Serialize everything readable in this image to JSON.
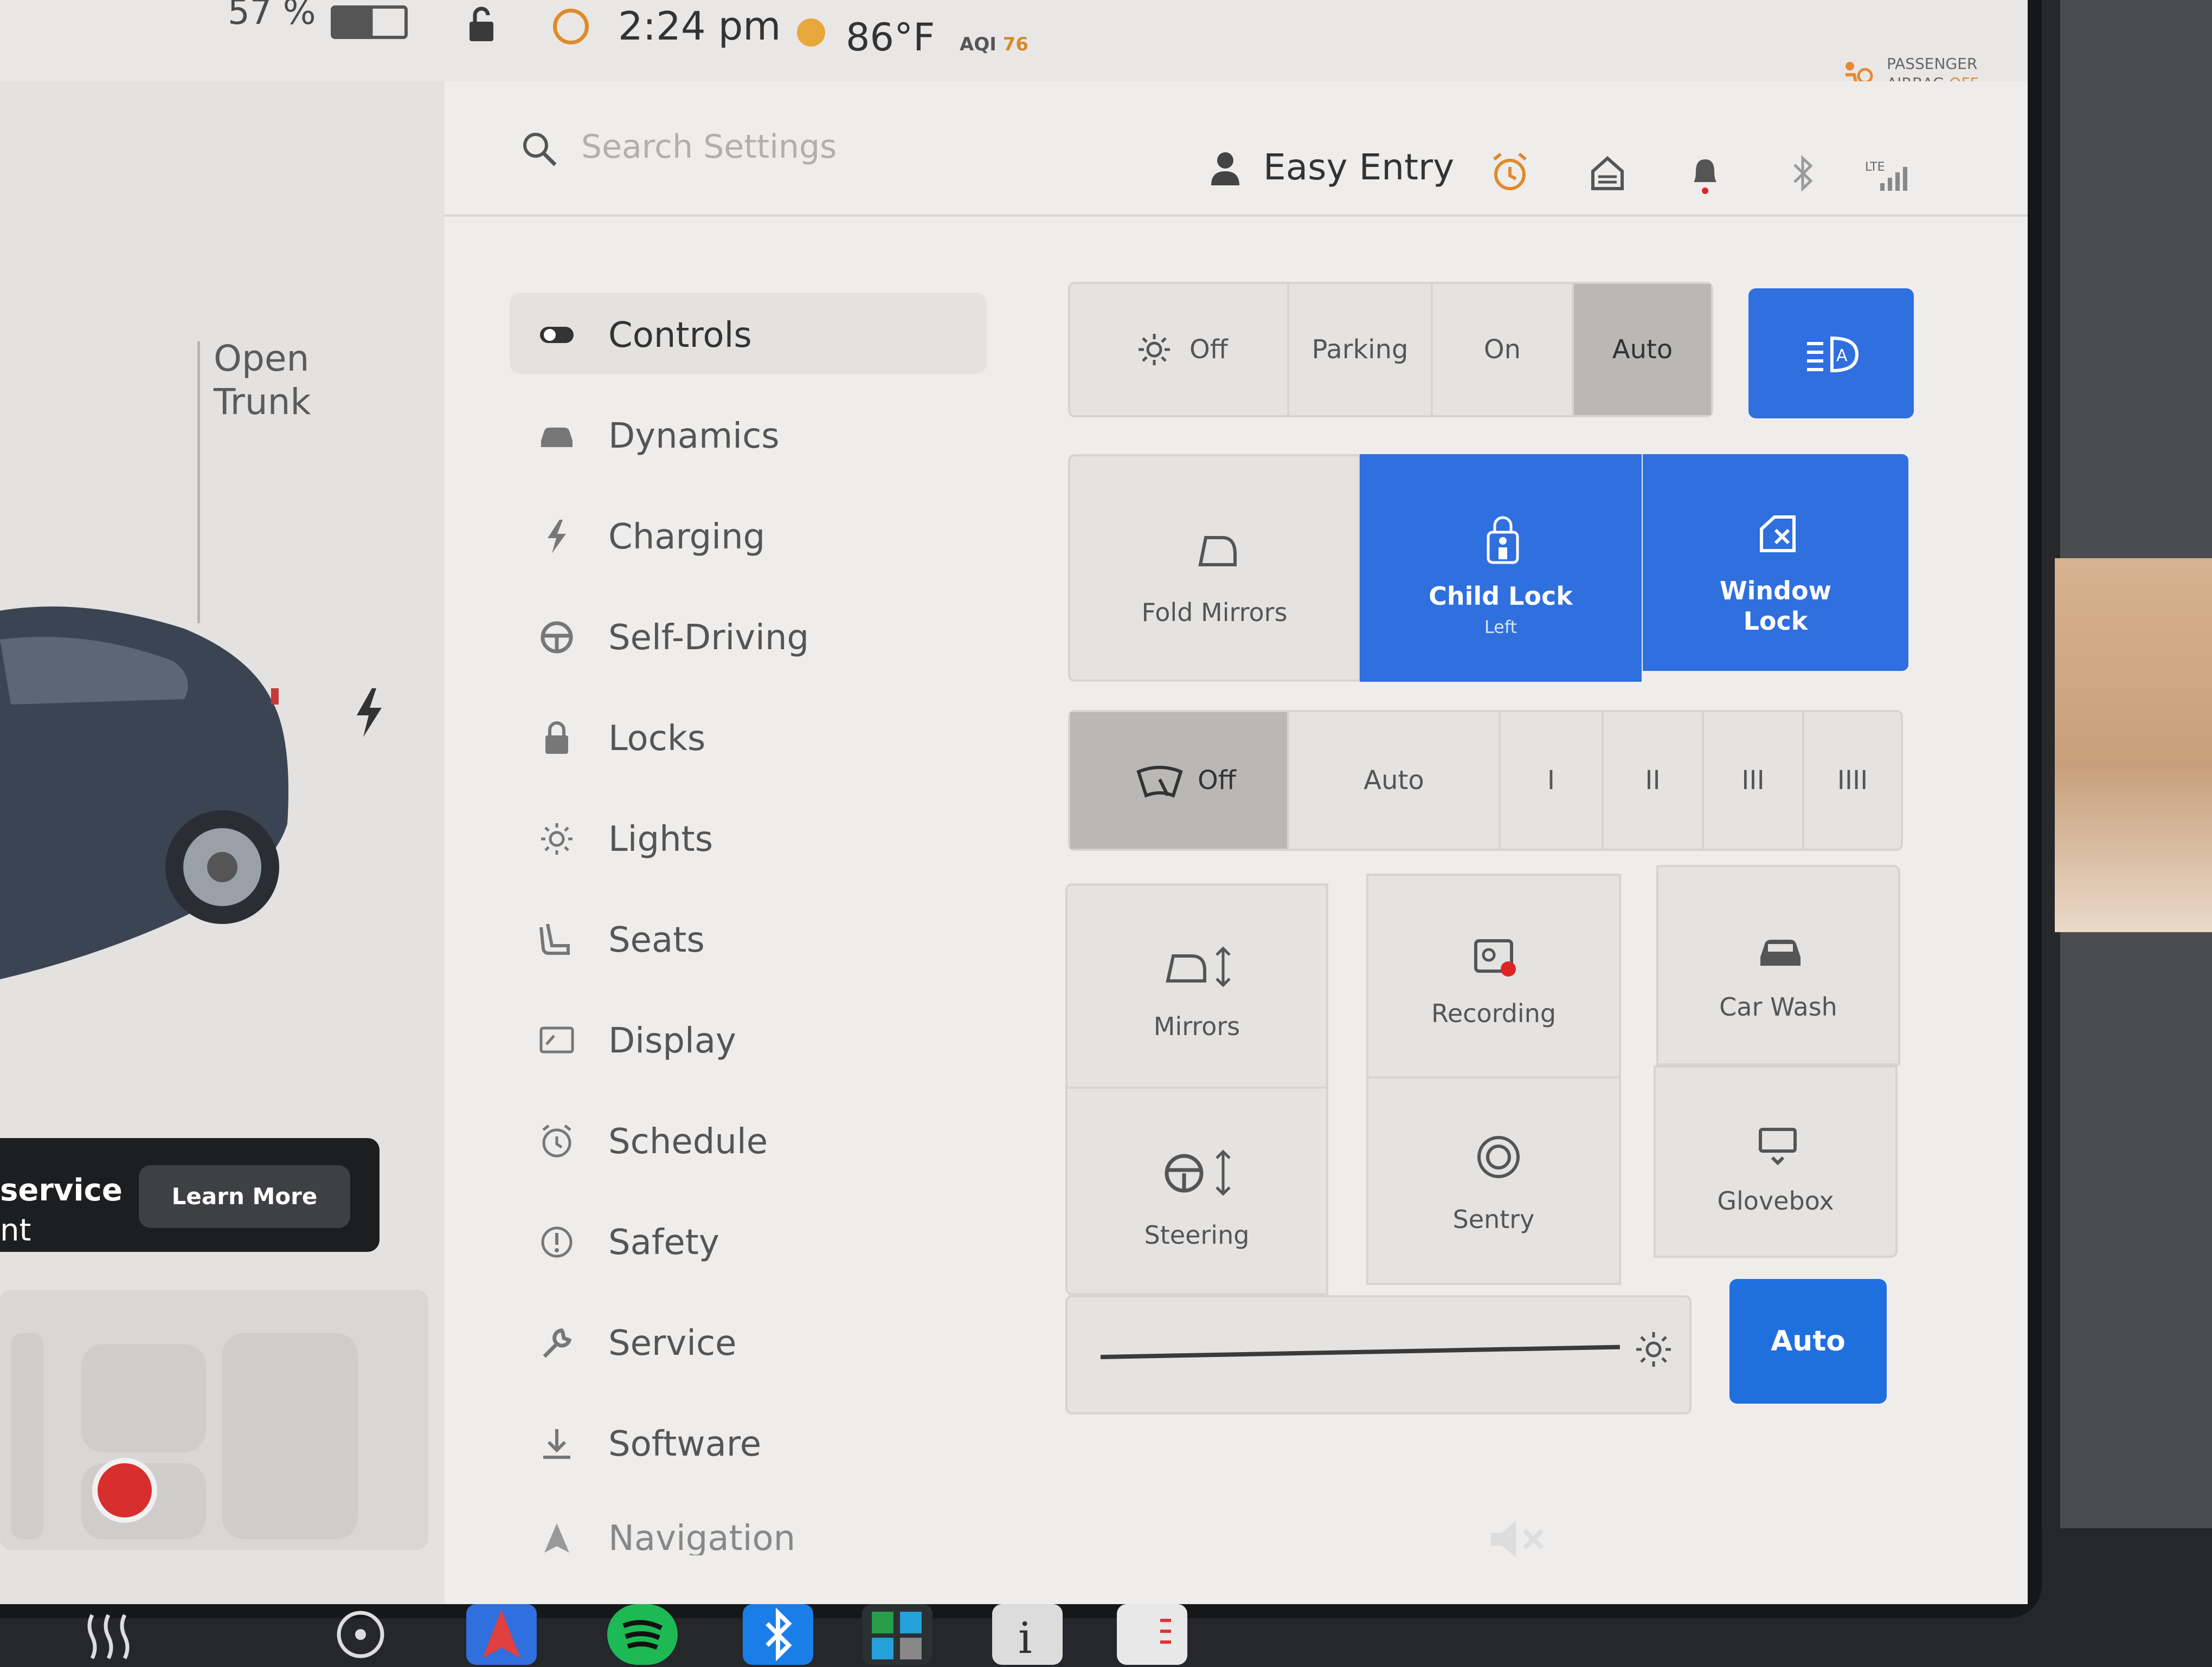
{
  "status": {
    "battery_percent": "57 %",
    "time": "2:24 pm",
    "temperature": "86°F",
    "aqi_label": "AQI",
    "aqi_value": "76",
    "airbag_line1": "PASSENGER",
    "airbag_line2": "AIRBAG",
    "airbag_state": "OFF",
    "lte": "LTE"
  },
  "car_panel": {
    "open_trunk_line1": "Open",
    "open_trunk_line2": "Trunk",
    "service_line1": "service",
    "service_line2": "nt",
    "learn_more": "Learn More"
  },
  "header": {
    "search_placeholder": "Search Settings",
    "profile_name": "Easy Entry"
  },
  "nav": {
    "items": [
      {
        "label": "Controls",
        "icon": "toggle-icon"
      },
      {
        "label": "Dynamics",
        "icon": "car-icon"
      },
      {
        "label": "Charging",
        "icon": "bolt-icon"
      },
      {
        "label": "Self-Driving",
        "icon": "steering-wheel-icon"
      },
      {
        "label": "Locks",
        "icon": "lock-icon"
      },
      {
        "label": "Lights",
        "icon": "light-icon"
      },
      {
        "label": "Seats",
        "icon": "seat-icon"
      },
      {
        "label": "Display",
        "icon": "display-icon"
      },
      {
        "label": "Schedule",
        "icon": "alarm-icon"
      },
      {
        "label": "Safety",
        "icon": "alert-icon"
      },
      {
        "label": "Service",
        "icon": "wrench-icon"
      },
      {
        "label": "Software",
        "icon": "download-icon"
      },
      {
        "label": "Navigation",
        "icon": "navigation-icon"
      }
    ]
  },
  "controls": {
    "headlights": {
      "off": "Off",
      "parking": "Parking",
      "on": "On",
      "auto": "Auto",
      "selected": "Auto"
    },
    "fold_mirrors": "Fold Mirrors",
    "child_lock": {
      "label": "Child Lock",
      "sub": "Left"
    },
    "window_lock": {
      "line1": "Window",
      "line2": "Lock"
    },
    "wipers": {
      "off": "Off",
      "auto": "Auto",
      "s1": "I",
      "s2": "II",
      "s3": "III",
      "s4": "IIII",
      "selected": "Off"
    },
    "tiles": {
      "mirrors": "Mirrors",
      "recording": "Recording",
      "car_wash": "Car Wash",
      "steering": "Steering",
      "sentry": "Sentry",
      "glovebox": "Glovebox"
    },
    "brightness_auto": "Auto",
    "brightness_level": 0.93
  },
  "colors": {
    "accent_blue": "#2f6fde",
    "alarm_orange": "#e08a2a",
    "record_red": "#e02424"
  }
}
